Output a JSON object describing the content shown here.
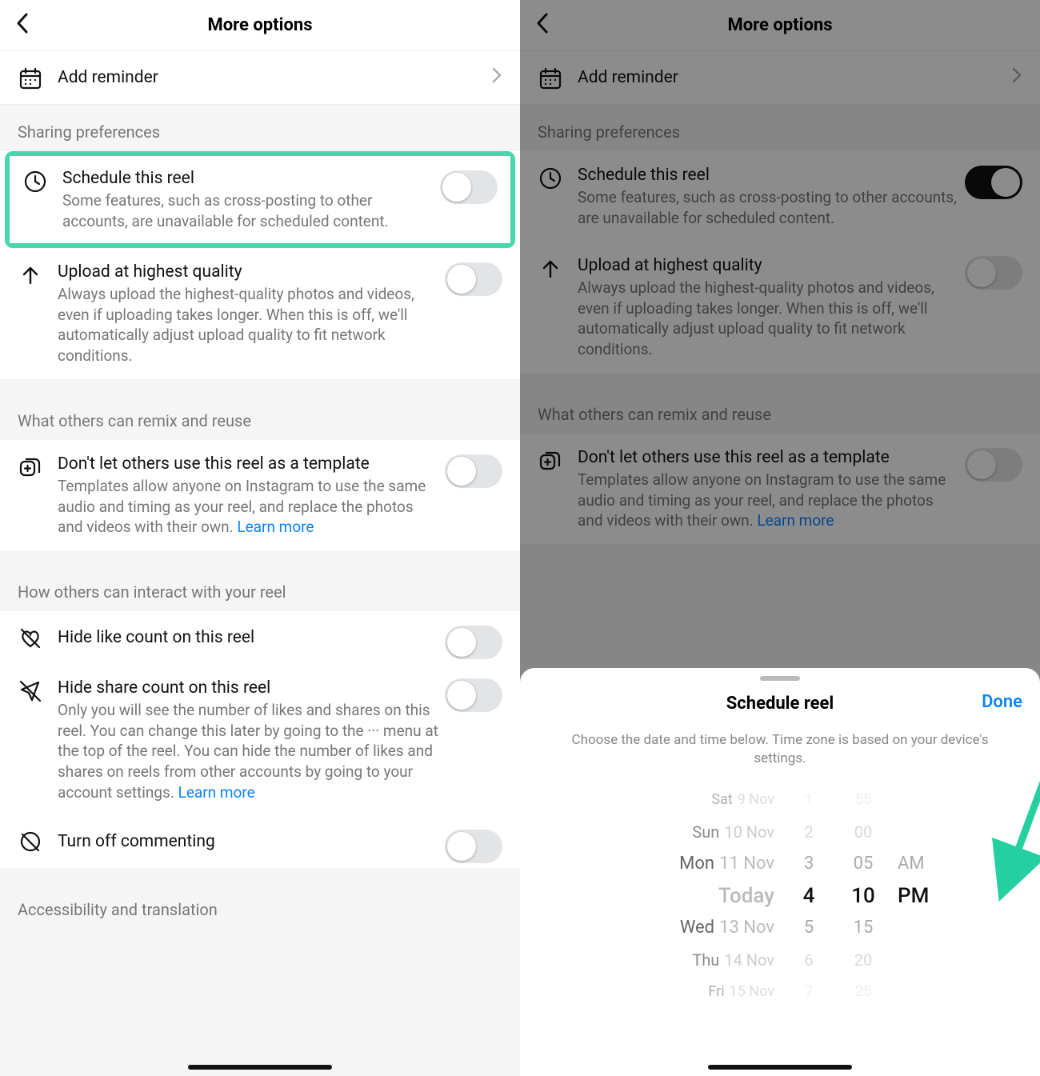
{
  "header": {
    "title": "More options"
  },
  "add_reminder": {
    "label": "Add reminder"
  },
  "sections": {
    "sharing_prefs": "Sharing preferences",
    "remix": "What others can remix and reuse",
    "interact": "How others can interact with your reel",
    "accessibility": "Accessibility and translation"
  },
  "schedule": {
    "title": "Schedule this reel",
    "desc": "Some features, such as cross-posting to other accounts, are unavailable for scheduled content."
  },
  "upload_quality": {
    "title": "Upload at highest quality",
    "desc": "Always upload the highest-quality photos and videos, even if uploading takes longer. When this is off, we'll automatically adjust upload quality to fit network conditions."
  },
  "template": {
    "title": "Don't let others use this reel as a template",
    "desc": "Templates allow anyone on Instagram to use the same audio and timing as your reel, and replace the photos and videos with their own. ",
    "learn_more": "Learn more"
  },
  "hide_likes": {
    "title": "Hide like count on this reel"
  },
  "hide_shares": {
    "title": "Hide share count on this reel",
    "desc": "Only you will see the number of likes and shares on this reel. You can change this later by going to the ··· menu at the top of the reel. You can hide the number of likes and shares on reels from other accounts by going to your account settings. ",
    "learn_more": "Learn more"
  },
  "turn_off_commenting": {
    "title": "Turn off commenting"
  },
  "sheet": {
    "title": "Schedule reel",
    "done": "Done",
    "subtitle": "Choose the date and time below. Time zone is based on your device's settings.",
    "dates": [
      {
        "dow": "Sat",
        "dnum": "9 Nov"
      },
      {
        "dow": "Sun",
        "dnum": "10 Nov"
      },
      {
        "dow": "Mon",
        "dnum": "11 Nov"
      },
      {
        "dow": "",
        "dnum": "Today"
      },
      {
        "dow": "Wed",
        "dnum": "13 Nov"
      },
      {
        "dow": "Thu",
        "dnum": "14 Nov"
      },
      {
        "dow": "Fri",
        "dnum": "15 Nov"
      }
    ],
    "hours": [
      "1",
      "2",
      "3",
      "4",
      "5",
      "6",
      "7"
    ],
    "mins": [
      "55",
      "00",
      "05",
      "10",
      "15",
      "20",
      "25"
    ],
    "ampm": [
      "",
      "",
      "AM",
      "PM",
      "",
      "",
      ""
    ]
  }
}
